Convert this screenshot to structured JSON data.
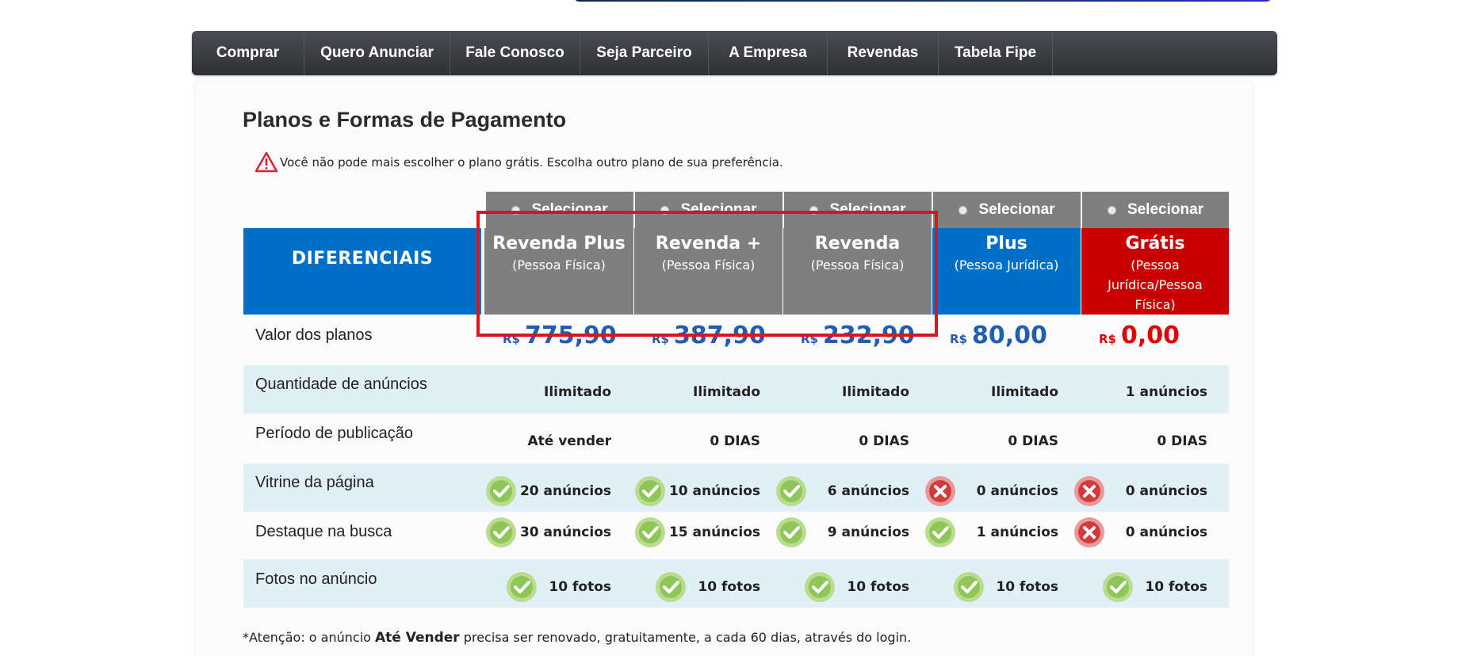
{
  "nav": {
    "items": [
      "Comprar",
      "Quero Anunciar",
      "Fale Conosco",
      "Seja Parceiro",
      "A Empresa",
      "Revendas",
      "Tabela Fipe"
    ]
  },
  "page": {
    "title": "Planos e Formas de Pagamento",
    "warning": "Você não pode mais escolher o plano grátis. Escolha outro plano de sua preferência."
  },
  "table": {
    "select_label": "Selecionar",
    "features_header": "DIFERENCIAIS",
    "currency": "R$",
    "plans": [
      {
        "name": "Revenda Plus",
        "subtitle": "(Pessoa Física)",
        "price": "775,90"
      },
      {
        "name": "Revenda +",
        "subtitle": "(Pessoa Física)",
        "price": "387,90"
      },
      {
        "name": "Revenda",
        "subtitle": "(Pessoa Física)",
        "price": "232,90"
      },
      {
        "name": "Plus",
        "subtitle": "(Pessoa Jurídica)",
        "price": "80,00"
      },
      {
        "name": "Grátis",
        "subtitle": "(Pessoa Jurídica/Pessoa Física)",
        "price": "0,00"
      }
    ],
    "rows": {
      "price_label": "Valor dos planos",
      "ads_label": "Quantidade de anúncios",
      "ads": [
        "Ilimitado",
        "Ilimitado",
        "Ilimitado",
        "Ilimitado",
        "1 anúncios"
      ],
      "period_label": "Período de publicação",
      "period": [
        "Até vender",
        "0 DIAS",
        "0 DIAS",
        "0 DIAS",
        "0 DIAS"
      ],
      "showcase_label": "Vitrine da página",
      "showcase": [
        "20 anúncios",
        "10 anúncios",
        "6 anúncios",
        "0 anúncios",
        "0 anúncios"
      ],
      "showcase_icons": [
        "check-icon",
        "check-icon",
        "check-icon",
        "x-icon",
        "x-icon"
      ],
      "highlight_label": "Destaque na busca",
      "highlight": [
        "30 anúncios",
        "15 anúncios",
        "9 anúncios",
        "1 anúncios",
        "0 anúncios"
      ],
      "highlight_icons": [
        "check-icon",
        "check-icon",
        "check-icon",
        "check-icon",
        "x-icon"
      ],
      "photos_label": "Fotos no anúncio",
      "photos": [
        "10 fotos",
        "10 fotos",
        "10 fotos",
        "10 fotos",
        "10 fotos"
      ],
      "photos_icons": [
        "check-icon",
        "check-icon",
        "check-icon",
        "check-icon",
        "check-icon"
      ]
    }
  },
  "footnote": {
    "prefix": "*Atenção: o anúncio ",
    "bold": "Até Vender",
    "suffix": " precisa ser renovado, gratuitamente, a cada 60 dias, através do login."
  },
  "colors": {
    "nav_bg": "#3c3e42",
    "plan_gray": "#7f7f7f",
    "plan_blue": "#006fc7",
    "plan_red": "#c80000",
    "price_blue": "#1f5fb3",
    "price_red": "#e00000",
    "row_alt": "#e1f0f7",
    "annotation_red": "#e0121f"
  }
}
